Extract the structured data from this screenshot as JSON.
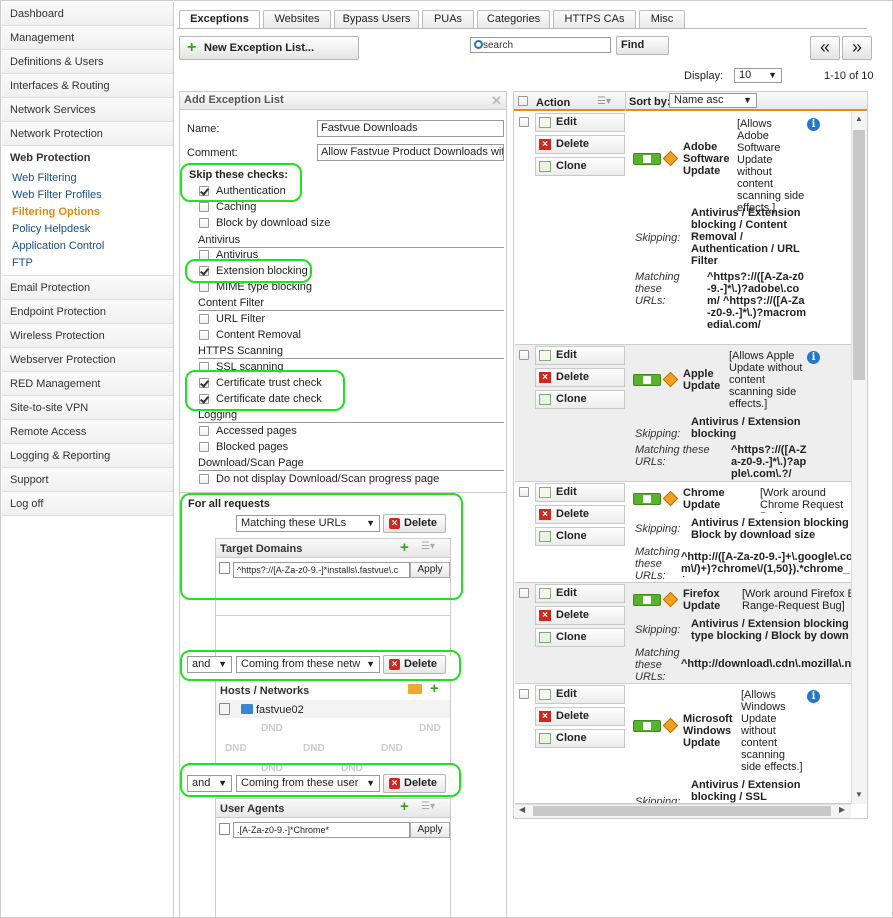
{
  "sidebar": {
    "items_top": [
      "Dashboard",
      "Management",
      "Definitions & Users",
      "Interfaces & Routing",
      "Network Services",
      "Network Protection"
    ],
    "active": "Web Protection",
    "sub_items": [
      "Web Filtering",
      "Web Filter Profiles",
      "Filtering Options",
      "Policy Helpdesk",
      "Application Control",
      "FTP"
    ],
    "items_bottom": [
      "Email Protection",
      "Endpoint Protection",
      "Wireless Protection",
      "Webserver Protection",
      "RED Management",
      "Site-to-site VPN",
      "Remote Access",
      "Logging & Reporting",
      "Support",
      "Log off"
    ]
  },
  "tabs": [
    "Exceptions",
    "Websites",
    "Bypass Users",
    "PUAs",
    "Categories",
    "HTTPS CAs",
    "Misc"
  ],
  "toolbar": {
    "new_button": "New Exception List...",
    "search_placeholder": "search",
    "find": "Find",
    "prev": "«",
    "next": "»",
    "display_label": "Display:",
    "display_value": "10",
    "range": "1-10 of 10"
  },
  "form": {
    "title": "Add Exception List",
    "name_label": "Name:",
    "name_value": "Fastvue Downloads",
    "comment_label": "Comment:",
    "comment_value": "Allow Fastvue Product Downloads with",
    "skip_label": "Skip these checks:",
    "checks": {
      "authentication": "Authentication",
      "caching": "Caching",
      "block_size": "Block by download size",
      "antivirus_section": "Antivirus",
      "antivirus": "Antivirus",
      "extension": "Extension blocking",
      "mime": "MIME type blocking",
      "content_section": "Content Filter",
      "url_filter": "URL Filter",
      "content_removal": "Content Removal",
      "https_section": "HTTPS Scanning",
      "ssl": "SSL scanning",
      "cert_trust": "Certificate trust check",
      "cert_date": "Certificate date check",
      "logging_section": "Logging",
      "accessed": "Accessed pages",
      "blocked": "Blocked pages",
      "download_section": "Download/Scan Page",
      "no_progress": "Do not display Download/Scan progress page"
    },
    "for_all": "For all requests",
    "match_urls": "Matching these URLs",
    "delete": "Delete",
    "target_domains": "Target Domains",
    "domain_value": "^https?://[A-Za-z0-9.-]*installs\\.fastvue\\.c",
    "apply": "Apply",
    "and": "and",
    "coming_networks": "Coming from these netw",
    "hosts_networks": "Hosts / Networks",
    "host_item": "fastvue02",
    "dnd": "DND",
    "coming_users": "Coming from these user",
    "user_agents": "User Agents",
    "agent_value": ".[A-Za-z0-9.-]*Chrome*"
  },
  "list": {
    "action": "Action",
    "sort_by": "Sort by:",
    "sort_value": "Name asc",
    "edit": "Edit",
    "delete": "Delete",
    "clone": "Clone",
    "skipping": "Skipping:",
    "matching_urls": "Matching these URLs:",
    "items": [
      {
        "name": "Adobe Software Update",
        "desc": "[Allows Adobe Software Update without content scanning side effects.]",
        "skip": "Antivirus / Extension blocking / Content Removal / Authentication / URL Filter",
        "urls": "^https?://([A-Za-z0-9.-]*\\.)?adobe\\.com/ ^https?://([A-Za-z0-9.-]*\\.)?macromedia\\.com/"
      },
      {
        "name": "Apple Update",
        "desc": "[Allows Apple Update without content scanning side effects.]",
        "skip": "Antivirus / Extension blocking",
        "urls": "^https?://([A-Za-z0-9.-]*\\.)?apple\\.com\\.?/"
      },
      {
        "name": "Chrome Update",
        "desc": "[Work around Chrome Request Bug]",
        "skip": "Antivirus / Extension blocking / Block by download size",
        "urls": "^http://([A-Za-z0-9.-]+\\.google\\.com\\/)+)?chrome\\/(1,50}).*chrome_(u"
      },
      {
        "name": "Firefox Update",
        "desc": "[Work around Firefox B Range-Request Bug]",
        "skip": "Antivirus / Extension blocking / type blocking / Block by down",
        "urls": "^http://download\\.cdn\\.mozilla\\.n"
      },
      {
        "name": "Microsoft Windows Update",
        "desc": "[Allows Windows Update without content scanning side effects.]",
        "skip": "Antivirus / Extension blocking / SSL",
        "urls": ""
      }
    ]
  }
}
